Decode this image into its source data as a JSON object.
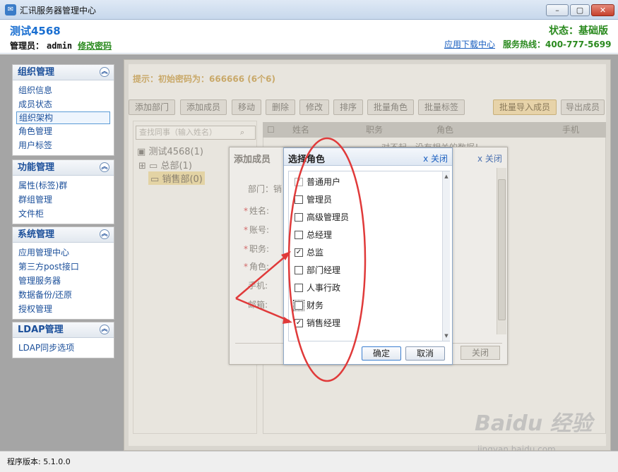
{
  "window": {
    "title": "汇讯服务器管理中心",
    "min": "–",
    "max": "▢",
    "close": "✕"
  },
  "header": {
    "account": "测试4568",
    "admin_label": "管理员：",
    "admin_user": "admin",
    "change_password": "修改密码",
    "status": "状态：基础版",
    "download": "应用下载中心",
    "hotline": "服务热线：400-777-5699"
  },
  "sidebar": {
    "groups": [
      {
        "title": "组织管理",
        "items": [
          "组织信息",
          "成员状态",
          "组织架构",
          "角色管理",
          "用户标签"
        ]
      },
      {
        "title": "功能管理",
        "items": [
          "属性(标签)群",
          "群组管理",
          "文件柜"
        ]
      },
      {
        "title": "系统管理",
        "items": [
          "应用管理中心",
          "第三方post接口",
          "管理服务器",
          "数据备份/还原",
          "授权管理"
        ]
      },
      {
        "title": "LDAP管理",
        "items": [
          "LDAP同步选项"
        ]
      }
    ],
    "collapse_glyph": "︽"
  },
  "content": {
    "tip": "提示：初始密码为：666666 (6个6)",
    "toolbar": [
      "添加部门",
      "添加成员",
      "移动",
      "删除",
      "修改",
      "排序",
      "批量角色",
      "批量标签"
    ],
    "import": "批量导入成员",
    "export": "导出成员",
    "search_placeholder": "查找同事（输入姓名）",
    "tree": {
      "root": "测试4568(1)",
      "dept1": "总部(1)",
      "dept2": "销售部(0)"
    },
    "grid_headers": [
      "姓名",
      "职务",
      "角色",
      "手机"
    ],
    "grid_empty": "对不起，没有相关的数据！"
  },
  "add_dialog": {
    "title": "添加成员",
    "close": "x 关闭",
    "close2": "x 关闭",
    "dept_label": "部门：销",
    "fields": [
      "姓名:",
      "账号:",
      "职务:",
      "角色:",
      "手机:",
      "邮箱:"
    ],
    "close_button": "关闭"
  },
  "role_dialog": {
    "title": "选择角色",
    "close": "x 关闭",
    "roles": [
      {
        "label": "普通用户",
        "checked": true,
        "disabled": true
      },
      {
        "label": "管理员",
        "checked": false
      },
      {
        "label": "高级管理员",
        "checked": false
      },
      {
        "label": "总经理",
        "checked": false
      },
      {
        "label": "总监",
        "checked": true
      },
      {
        "label": "部门经理",
        "checked": false
      },
      {
        "label": "人事行政",
        "checked": false
      },
      {
        "label": "财务",
        "checked": false,
        "focus": true
      },
      {
        "label": "销售经理",
        "checked": true
      }
    ],
    "ok": "确定",
    "cancel": "取消"
  },
  "statusbar": {
    "version": "程序版本: 5.1.0.0"
  },
  "watermark": {
    "brand": "Baidu 经验",
    "url": "jingyan.baidu.com"
  },
  "colors": {
    "accent": "#1a6fd1",
    "status_green": "#2a8a1e",
    "annotation_red": "#e03a3a"
  }
}
